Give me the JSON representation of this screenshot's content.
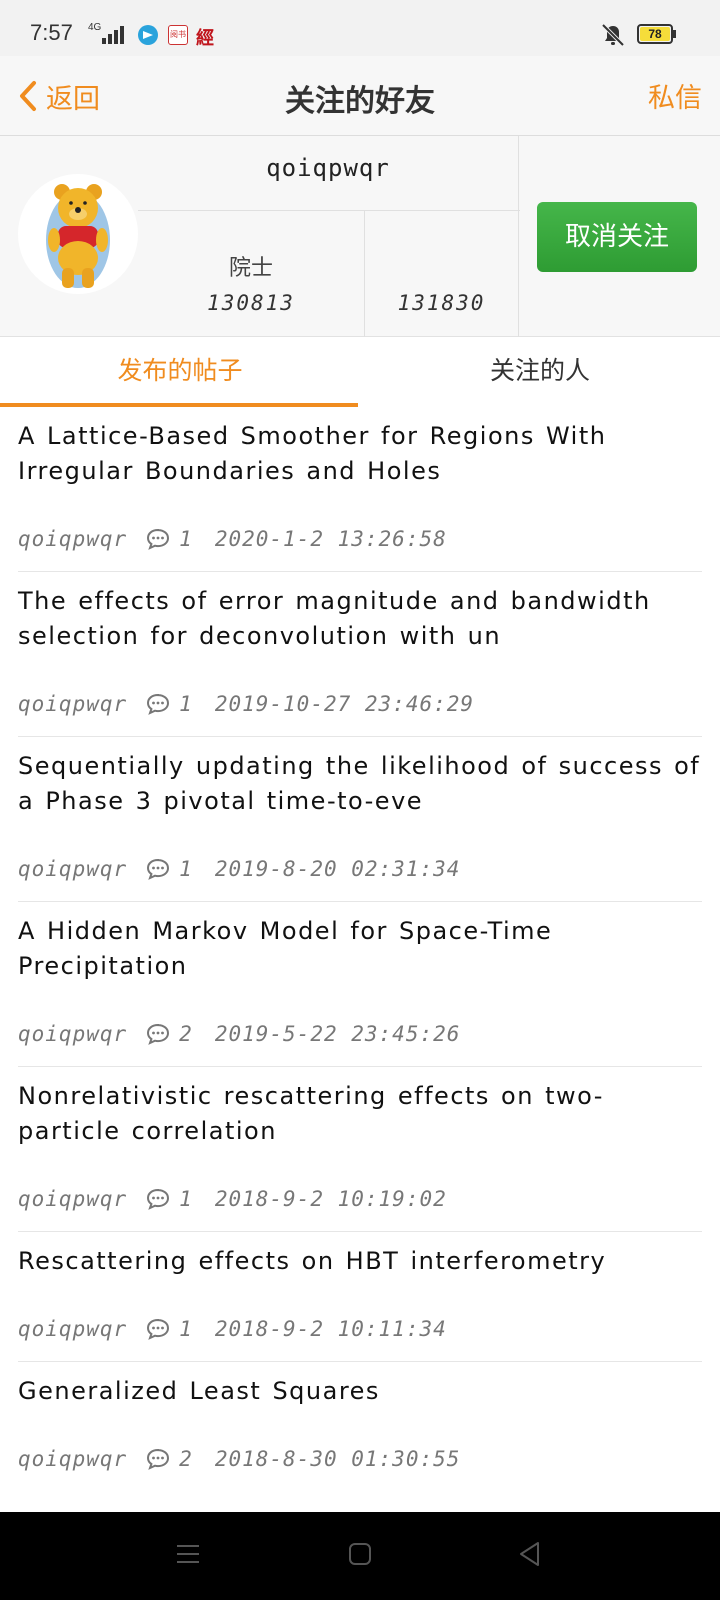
{
  "status_bar": {
    "time": "7:57",
    "network": "4G",
    "app_icon_1": "阅书",
    "app_icon_2": "經",
    "battery": "78",
    "icons": [
      "signal-icon",
      "telegram-icon",
      "mute-icon",
      "battery-icon"
    ]
  },
  "nav": {
    "back_label": "返回",
    "title": "关注的好友",
    "message_label": "私信"
  },
  "profile": {
    "username": "qoiqpwqr",
    "rank": "院士",
    "stat_1": "130813",
    "stat_2": "131830",
    "unfollow_label": "取消关注"
  },
  "tabs": {
    "posts_label": "发布的帖子",
    "following_label": "关注的人",
    "active": "posts"
  },
  "posts": [
    {
      "title": "A Lattice-Based Smoother for Regions With Irregular Boundaries and Holes",
      "author": "qoiqpwqr",
      "comments": "1",
      "time": "2020-1-2 13:26:58"
    },
    {
      "title": "The effects of error magnitude and bandwidth selection for deconvolution with un",
      "author": "qoiqpwqr",
      "comments": "1",
      "time": "2019-10-27 23:46:29"
    },
    {
      "title": "Sequentially updating the likelihood of success of a Phase 3 pivotal time-to-eve",
      "author": "qoiqpwqr",
      "comments": "1",
      "time": "2019-8-20 02:31:34"
    },
    {
      "title": "A Hidden Markov Model for Space-Time Precipitation",
      "author": "qoiqpwqr",
      "comments": "2",
      "time": "2019-5-22 23:45:26"
    },
    {
      "title": "Nonrelativistic rescattering effects on two-particle correlation",
      "author": "qoiqpwqr",
      "comments": "1",
      "time": "2018-9-2 10:19:02"
    },
    {
      "title": "Rescattering effects on HBT interferometry",
      "author": "qoiqpwqr",
      "comments": "1",
      "time": "2018-9-2 10:11:34"
    },
    {
      "title": "Generalized Least Squares",
      "author": "qoiqpwqr",
      "comments": "2",
      "time": "2018-8-30 01:30:55"
    }
  ],
  "colors": {
    "accent": "#f08c1f",
    "button_green": "#3aa83f",
    "status_bar_bg": "#f2f2f2"
  }
}
